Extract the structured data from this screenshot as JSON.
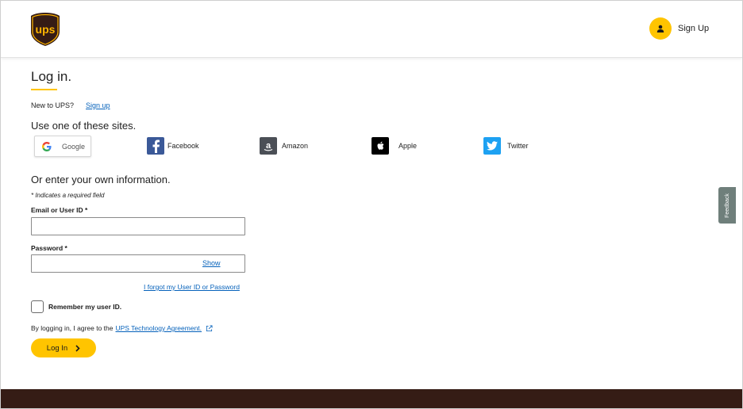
{
  "header": {
    "logo_text": "ups",
    "signup_label": "Sign Up",
    "icons": {
      "account": "user-icon"
    }
  },
  "page": {
    "title": "Log in.",
    "new_prompt": "New to UPS?",
    "signup_link": "Sign up"
  },
  "social": {
    "heading": "Use one of these sites.",
    "providers": [
      {
        "label": "Google",
        "icon": "google-icon"
      },
      {
        "label": "Facebook",
        "icon": "facebook-icon"
      },
      {
        "label": "Amazon",
        "icon": "amazon-icon"
      },
      {
        "label": "Apple",
        "icon": "apple-icon"
      },
      {
        "label": "Twitter",
        "icon": "twitter-icon"
      }
    ]
  },
  "form": {
    "heading": "Or enter your own information.",
    "required_note": "* Indicates a required field",
    "email_label": "Email or User ID *",
    "email_value": "",
    "password_label": "Password *",
    "password_value": "",
    "show_label": "Show",
    "forgot_label": "I forgot my User ID or Password",
    "remember_label": "Remember my user ID.",
    "remember_checked": false,
    "agree_prefix": "By logging in, I agree to the",
    "agree_link": "UPS Technology Agreement.",
    "login_label": "Log In"
  },
  "feedback_label": "Feedback",
  "colors": {
    "brand_gold": "#ffc400",
    "brand_brown": "#351c15",
    "link_blue": "#0662bb",
    "facebook": "#3b5998",
    "amazon": "#4b4f56",
    "apple": "#000000",
    "twitter": "#1da1f2",
    "feedback_tab": "#6f7f7b"
  }
}
